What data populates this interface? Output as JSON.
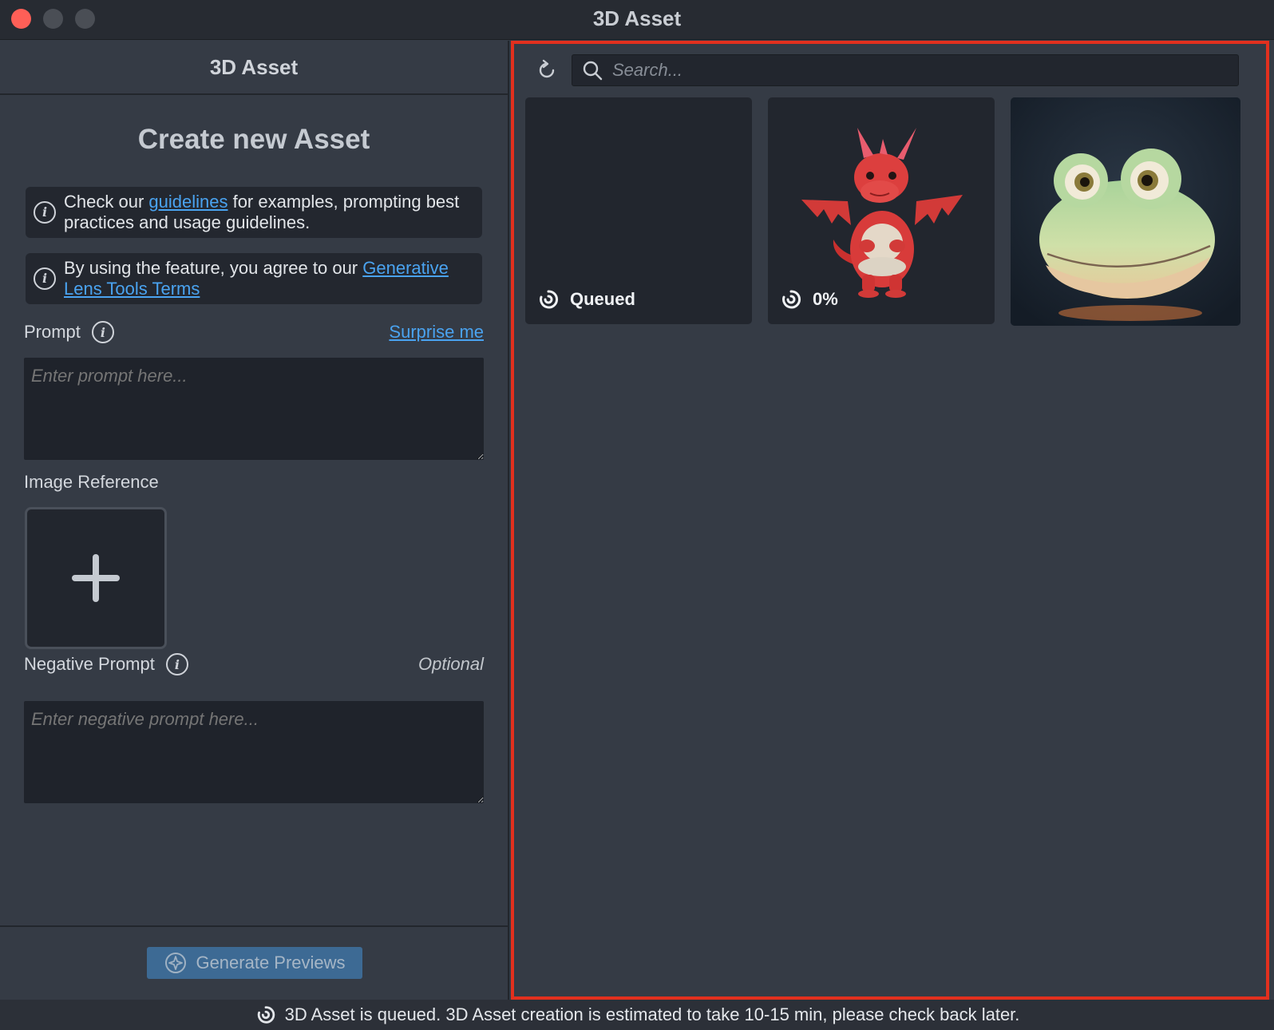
{
  "window": {
    "title": "3D Asset",
    "traffic_lights": [
      "close",
      "minimize",
      "maximize"
    ]
  },
  "left_panel": {
    "header": "3D Asset",
    "title": "Create new Asset",
    "info_guidelines": {
      "prefix": "Check our ",
      "link": "guidelines",
      "suffix": " for examples, prompting best practices and usage guidelines."
    },
    "info_terms": {
      "prefix": "By using the feature, you agree to our ",
      "link": "Generative Lens Tools Terms"
    },
    "prompt": {
      "label": "Prompt",
      "surprise_label": "Surprise me",
      "placeholder": "Enter prompt here...",
      "value": ""
    },
    "image_reference": {
      "label": "Image Reference"
    },
    "negative_prompt": {
      "label": "Negative Prompt",
      "optional_label": "Optional",
      "placeholder": "Enter negative prompt here...",
      "value": ""
    },
    "generate_label": "Generate Previews"
  },
  "right_panel": {
    "search": {
      "placeholder": "Search...",
      "value": ""
    },
    "tiles": [
      {
        "status": "Queued",
        "subject": ""
      },
      {
        "status": "0%",
        "subject": "red-dragon"
      },
      {
        "status": "",
        "subject": "frog"
      }
    ]
  },
  "status_bar": {
    "message": "3D Asset is queued. 3D Asset creation is estimated to take 10-15 min, please check back later."
  },
  "colors": {
    "accent_link": "#4aa3f0",
    "highlight_border": "#e2301e",
    "close_light": "#fe5f57",
    "button_bg": "#3d6a94"
  }
}
